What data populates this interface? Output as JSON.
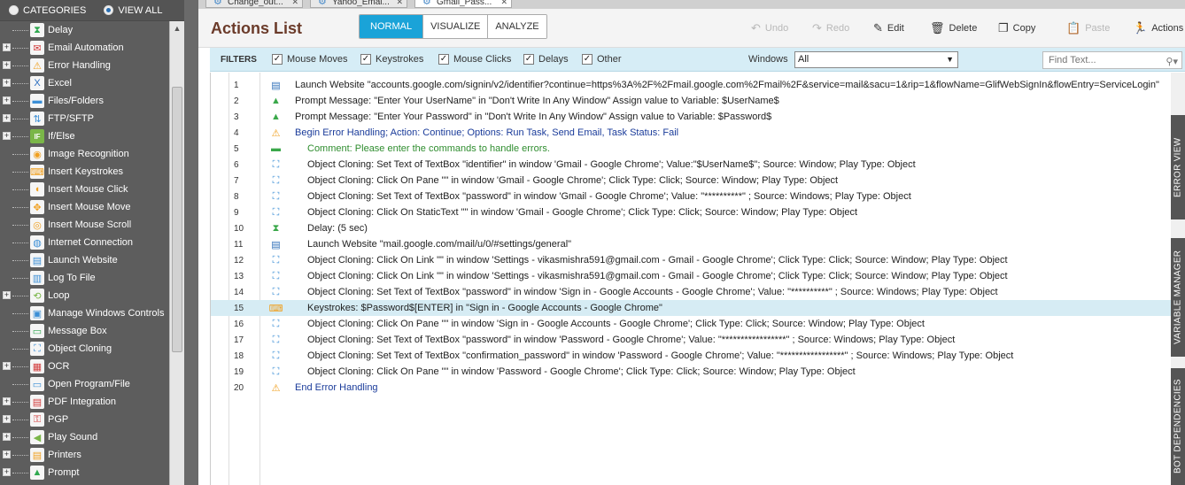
{
  "sidebar": {
    "categories_label": "CATEGORIES",
    "view_all_label": "VIEW ALL",
    "items": [
      {
        "label": "Delay",
        "icon": "hourglass-icon",
        "expandable": false,
        "glyph": "⧗",
        "color": "#2fa84f"
      },
      {
        "label": "Email Automation",
        "icon": "email-automation-icon",
        "expandable": true,
        "glyph": "✉",
        "color": "#d23b3b"
      },
      {
        "label": "Error Handling",
        "icon": "warning-icon",
        "expandable": true,
        "glyph": "⚠",
        "color": "#f0a020"
      },
      {
        "label": "Excel",
        "icon": "excel-icon",
        "expandable": true,
        "glyph": "X",
        "color": "#2e6fc0"
      },
      {
        "label": "Files/Folders",
        "icon": "folder-icon",
        "expandable": true,
        "glyph": "▬",
        "color": "#3c8fd6"
      },
      {
        "label": "FTP/SFTP",
        "icon": "ftp-icon",
        "expandable": true,
        "glyph": "⇅",
        "color": "#3c8fd6"
      },
      {
        "label": "If/Else",
        "icon": "if-else-icon",
        "expandable": true,
        "glyph": "IF",
        "color": "#7ab648"
      },
      {
        "label": "Image Recognition",
        "icon": "image-recognition-icon",
        "expandable": false,
        "glyph": "◉",
        "color": "#f0a020"
      },
      {
        "label": "Insert Keystrokes",
        "icon": "keystrokes-icon",
        "expandable": false,
        "glyph": "⌨",
        "color": "#f0a020"
      },
      {
        "label": "Insert Mouse Click",
        "icon": "mouse-click-icon",
        "expandable": false,
        "glyph": "◖",
        "color": "#f0a020"
      },
      {
        "label": "Insert Mouse Move",
        "icon": "mouse-move-icon",
        "expandable": false,
        "glyph": "✥",
        "color": "#f0a020"
      },
      {
        "label": "Insert Mouse Scroll",
        "icon": "mouse-scroll-icon",
        "expandable": false,
        "glyph": "◎",
        "color": "#f0a020"
      },
      {
        "label": "Internet Connection",
        "icon": "globe-icon",
        "expandable": false,
        "glyph": "◍",
        "color": "#3c8fd6"
      },
      {
        "label": "Launch Website",
        "icon": "launch-website-icon",
        "expandable": false,
        "glyph": "▤",
        "color": "#3c8fd6"
      },
      {
        "label": "Log To File",
        "icon": "log-file-icon",
        "expandable": false,
        "glyph": "▥",
        "color": "#3c8fd6"
      },
      {
        "label": "Loop",
        "icon": "loop-icon",
        "expandable": true,
        "glyph": "⟲",
        "color": "#7ab648"
      },
      {
        "label": "Manage Windows Controls",
        "icon": "windows-controls-icon",
        "expandable": false,
        "glyph": "▣",
        "color": "#3c8fd6"
      },
      {
        "label": "Message Box",
        "icon": "message-box-icon",
        "expandable": false,
        "glyph": "▭",
        "color": "#2fa84f"
      },
      {
        "label": "Object Cloning",
        "icon": "object-cloning-icon",
        "expandable": false,
        "glyph": "⛶",
        "color": "#3c8fd6"
      },
      {
        "label": "OCR",
        "icon": "ocr-icon",
        "expandable": true,
        "glyph": "▦",
        "color": "#d23b3b"
      },
      {
        "label": "Open Program/File",
        "icon": "open-program-icon",
        "expandable": false,
        "glyph": "▭",
        "color": "#3c8fd6"
      },
      {
        "label": "PDF Integration",
        "icon": "pdf-icon",
        "expandable": true,
        "glyph": "▤",
        "color": "#d23b3b"
      },
      {
        "label": "PGP",
        "icon": "pgp-icon",
        "expandable": true,
        "glyph": "⚿",
        "color": "#d23b3b"
      },
      {
        "label": "Play Sound",
        "icon": "speaker-icon",
        "expandable": true,
        "glyph": "◀",
        "color": "#7ab648"
      },
      {
        "label": "Printers",
        "icon": "printer-icon",
        "expandable": true,
        "glyph": "▤",
        "color": "#f0a020"
      },
      {
        "label": "Prompt",
        "icon": "prompt-icon",
        "expandable": true,
        "glyph": "▲",
        "color": "#2fa84f"
      }
    ]
  },
  "tabs": [
    {
      "label": "Change_out...",
      "active": false
    },
    {
      "label": "Yahoo_Emai...",
      "active": false
    },
    {
      "label": "Gmail_Pass...",
      "active": true
    }
  ],
  "toolbar": {
    "title": "Actions List",
    "modes": [
      "NORMAL",
      "VISUALIZE",
      "ANALYZE"
    ],
    "active_mode": "NORMAL",
    "buttons": [
      {
        "label": "Undo",
        "icon": "undo-icon",
        "glyph": "↶",
        "disabled": true
      },
      {
        "label": "Redo",
        "icon": "redo-icon",
        "glyph": "↷",
        "disabled": true
      },
      {
        "label": "Edit",
        "icon": "edit-icon",
        "glyph": "✎",
        "disabled": false
      },
      {
        "label": "Delete",
        "icon": "trash-icon",
        "glyph": "🗑",
        "disabled": false
      },
      {
        "label": "Copy",
        "icon": "copy-icon",
        "glyph": "❐",
        "disabled": false
      },
      {
        "label": "Paste",
        "icon": "paste-icon",
        "glyph": "📋",
        "disabled": true
      },
      {
        "label": "Actions",
        "icon": "actions-icon",
        "glyph": "🏃",
        "disabled": false
      }
    ]
  },
  "filters": {
    "label": "FILTERS",
    "checks": [
      {
        "label": "Mouse Moves",
        "checked": true
      },
      {
        "label": "Keystrokes",
        "checked": true
      },
      {
        "label": "Mouse Clicks",
        "checked": true
      },
      {
        "label": "Delays",
        "checked": true
      },
      {
        "label": "Other",
        "checked": true
      }
    ],
    "windows_label": "Windows",
    "windows_value": "All",
    "find_placeholder": "Find Text..."
  },
  "actions": [
    {
      "n": "1",
      "indent": 0,
      "icon": "launch-website-icon",
      "text": "Launch Website \"accounts.google.com/signin/v2/identifier?continue=https%3A%2F%2Fmail.google.com%2Fmail%2F&service=mail&sacu=1&rip=1&flowName=GlifWebSignIn&flowEntry=ServiceLogin\"",
      "style": "normal"
    },
    {
      "n": "2",
      "indent": 0,
      "icon": "prompt-icon",
      "text": "Prompt Message: \"Enter Your UserName\" in \"Don't Write In Any Window\" Assign value to Variable: $UserName$",
      "style": "normal"
    },
    {
      "n": "3",
      "indent": 0,
      "icon": "prompt-icon",
      "text": "Prompt Message: \"Enter Your Password\" in \"Don't Write In Any Window\" Assign value to Variable: $Password$",
      "style": "normal"
    },
    {
      "n": "4",
      "indent": 0,
      "icon": "warning-icon",
      "text": "Begin Error Handling; Action: Continue; Options: Run Task, Send Email, Task Status: Fail",
      "style": "blue"
    },
    {
      "n": "5",
      "indent": 1,
      "icon": "comment-icon",
      "text": "Comment: Please enter the commands to handle errors.",
      "style": "green"
    },
    {
      "n": "6",
      "indent": 1,
      "icon": "object-cloning-icon",
      "text": "Object Cloning: Set Text of TextBox \"identifier\" in window 'Gmail - Google Chrome'; Value:\"$UserName$\"; Source: Window; Play Type: Object",
      "style": "normal"
    },
    {
      "n": "7",
      "indent": 1,
      "icon": "object-cloning-icon",
      "text": "Object Cloning: Click On Pane \"\" in window 'Gmail - Google Chrome'; Click Type: Click; Source: Window; Play Type: Object",
      "style": "normal"
    },
    {
      "n": "8",
      "indent": 1,
      "icon": "object-cloning-icon",
      "text": "Object Cloning: Set Text of TextBox \"password\" in window 'Gmail - Google Chrome'; Value: \"**********\" ; Source: Windows; Play Type: Object",
      "style": "normal"
    },
    {
      "n": "9",
      "indent": 1,
      "icon": "object-cloning-icon",
      "text": "Object Cloning: Click On StaticText \"\" in window 'Gmail - Google Chrome'; Click Type: Click; Source: Window; Play Type: Object",
      "style": "normal"
    },
    {
      "n": "10",
      "indent": 1,
      "icon": "hourglass-icon",
      "text": "Delay: (5 sec)",
      "style": "normal"
    },
    {
      "n": "11",
      "indent": 1,
      "icon": "launch-website-icon",
      "text": "Launch Website \"mail.google.com/mail/u/0/#settings/general\"",
      "style": "normal"
    },
    {
      "n": "12",
      "indent": 1,
      "icon": "object-cloning-icon",
      "text": "Object Cloning: Click On Link \"\" in window 'Settings - vikasmishra591@gmail.com - Gmail - Google Chrome'; Click Type: Click; Source: Window; Play Type: Object",
      "style": "normal"
    },
    {
      "n": "13",
      "indent": 1,
      "icon": "object-cloning-icon",
      "text": "Object Cloning: Click On Link \"\" in window 'Settings - vikasmishra591@gmail.com - Gmail - Google Chrome'; Click Type: Click; Source: Window; Play Type: Object",
      "style": "normal"
    },
    {
      "n": "14",
      "indent": 1,
      "icon": "object-cloning-icon",
      "text": "Object Cloning: Set Text of TextBox \"password\" in window 'Sign in - Google Accounts - Google Chrome'; Value: \"**********\" ; Source: Windows; Play Type: Object",
      "style": "normal"
    },
    {
      "n": "15",
      "indent": 1,
      "icon": "keystrokes-icon",
      "text": "Keystrokes: $Password$[ENTER] in \"Sign in - Google Accounts - Google Chrome\"",
      "style": "normal",
      "selected": true
    },
    {
      "n": "16",
      "indent": 1,
      "icon": "object-cloning-icon",
      "text": "Object Cloning: Click On Pane \"\" in window 'Sign in - Google Accounts - Google Chrome'; Click Type: Click; Source: Window; Play Type: Object",
      "style": "normal"
    },
    {
      "n": "17",
      "indent": 1,
      "icon": "object-cloning-icon",
      "text": "Object Cloning: Set Text of TextBox \"password\" in window 'Password - Google Chrome'; Value: \"*****************\" ; Source: Windows; Play Type: Object",
      "style": "normal"
    },
    {
      "n": "18",
      "indent": 1,
      "icon": "object-cloning-icon",
      "text": "Object Cloning: Set Text of TextBox \"confirmation_password\" in window 'Password - Google Chrome'; Value: \"*****************\" ; Source: Windows; Play Type: Object",
      "style": "normal"
    },
    {
      "n": "19",
      "indent": 1,
      "icon": "object-cloning-icon",
      "text": "Object Cloning: Click On Pane \"\" in window 'Password - Google Chrome'; Click Type: Click; Source: Window; Play Type: Object",
      "style": "normal"
    },
    {
      "n": "20",
      "indent": 0,
      "icon": "warning-icon",
      "text": "End Error Handling",
      "style": "blue"
    }
  ],
  "side_tabs": [
    "ERROR VIEW",
    "VARIABLE MANAGER",
    "BOT DEPENDENCIES"
  ],
  "colors": {
    "accent": "#1aa3d8",
    "title": "#6b3b2a",
    "filter_bg": "#d6edf6",
    "selected_row": "#d6ecf4",
    "sidebar_bg": "#5d5d5d"
  }
}
